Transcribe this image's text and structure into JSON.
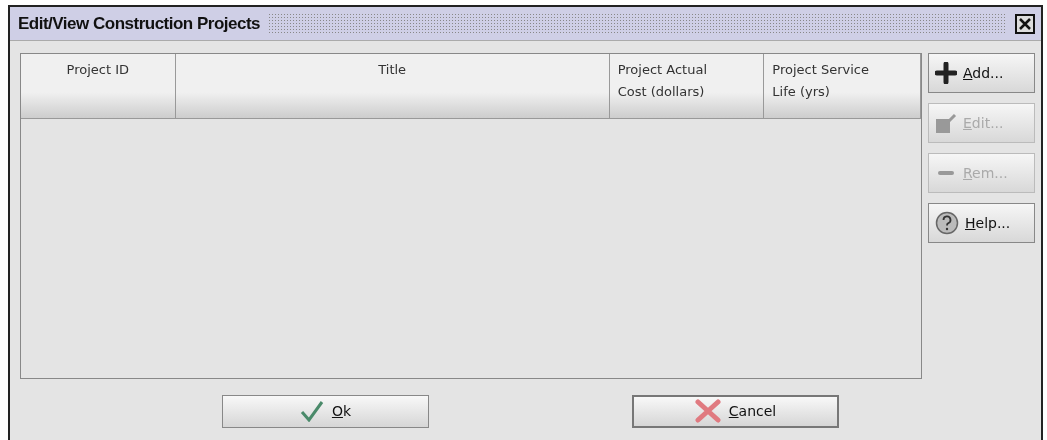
{
  "window": {
    "title": "Edit/View Construction Projects"
  },
  "table": {
    "columns": [
      {
        "label": "Project ID"
      },
      {
        "label": "Title"
      },
      {
        "label": "Project Actual\nCost (dollars)"
      },
      {
        "label": "Project Service\nLife (yrs)"
      }
    ]
  },
  "side_buttons": [
    {
      "label": "Add...",
      "kind": "add",
      "disabled": false
    },
    {
      "label": "Edit...",
      "kind": "edit",
      "disabled": true
    },
    {
      "label": "Rem...",
      "kind": "remove",
      "disabled": true
    },
    {
      "label": "Help...",
      "kind": "help",
      "disabled": false
    }
  ],
  "footer_buttons": [
    {
      "label": "Ok",
      "kind": "ok",
      "default": false
    },
    {
      "label": "Cancel",
      "kind": "cancel",
      "default": true
    }
  ]
}
